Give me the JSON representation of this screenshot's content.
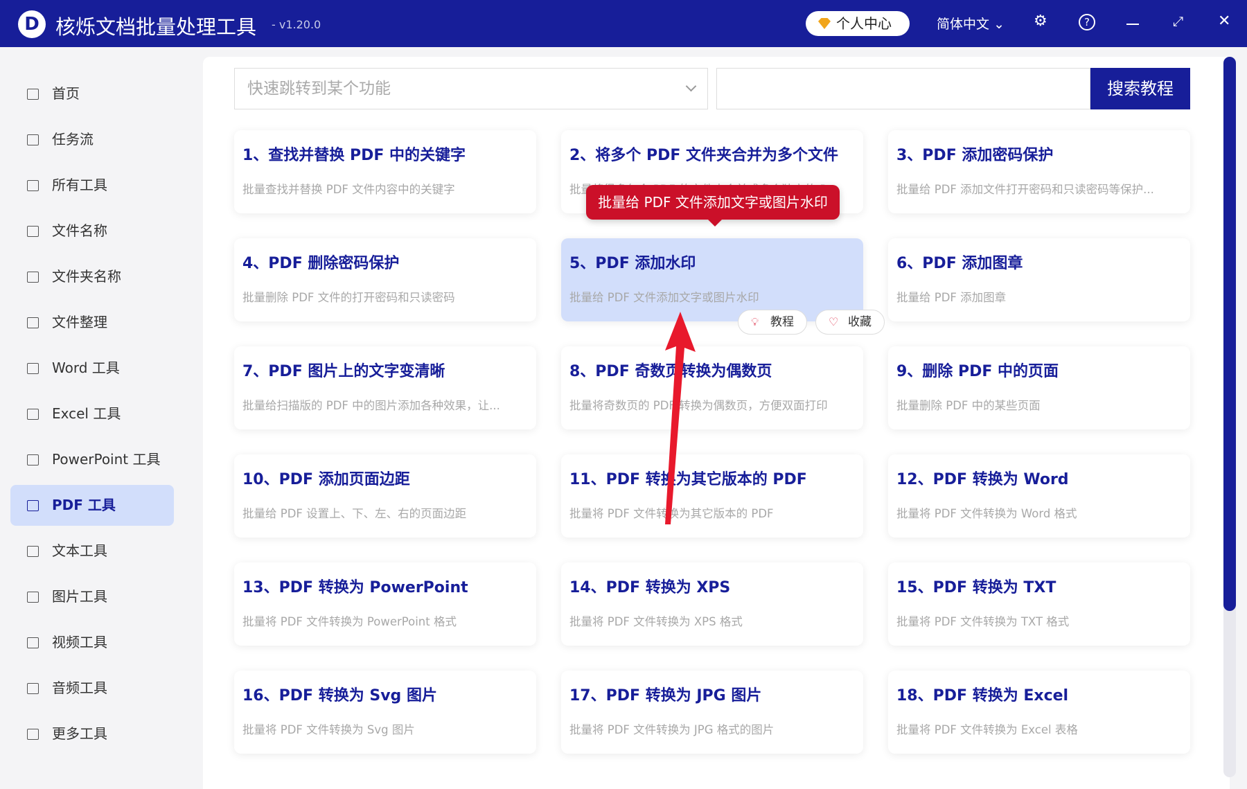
{
  "app": {
    "logo": "D",
    "title": "核烁文档批量处理工具",
    "version": "- v1.20.0",
    "user_center": "个人中心",
    "language": "简体中文"
  },
  "sidebar": {
    "items": [
      {
        "label": "首页",
        "icon": "home-icon"
      },
      {
        "label": "任务流",
        "icon": "workflow-icon"
      },
      {
        "label": "所有工具",
        "icon": "monitor-icon"
      },
      {
        "label": "文件名称",
        "icon": "file-icon"
      },
      {
        "label": "文件夹名称",
        "icon": "folder-icon"
      },
      {
        "label": "文件整理",
        "icon": "organize-icon"
      },
      {
        "label": "Word 工具",
        "icon": "word-icon"
      },
      {
        "label": "Excel 工具",
        "icon": "excel-icon"
      },
      {
        "label": "PowerPoint 工具",
        "icon": "ppt-icon"
      },
      {
        "label": "PDF 工具",
        "icon": "pdf-icon",
        "active": true
      },
      {
        "label": "文本工具",
        "icon": "text-icon"
      },
      {
        "label": "图片工具",
        "icon": "image-icon"
      },
      {
        "label": "视频工具",
        "icon": "video-icon"
      },
      {
        "label": "音频工具",
        "icon": "mic-icon"
      },
      {
        "label": "更多工具",
        "icon": "grid-icon"
      }
    ]
  },
  "search": {
    "placeholder": "快速跳转到某个功能",
    "button": "搜索教程"
  },
  "cards": [
    {
      "title": "1、查找并替换 PDF 中的关键字",
      "desc": "批量查找并替换 PDF 文件内容中的关键字"
    },
    {
      "title": "2、将多个 PDF 文件夹合并为多个文件",
      "desc": "批量将很多包含 PDF 的文件夹合并成多个独立的 P..."
    },
    {
      "title": "3、PDF 添加密码保护",
      "desc": "批量给 PDF 添加文件打开密码和只读密码等保护..."
    },
    {
      "title": "4、PDF 删除密码保护",
      "desc": "批量删除 PDF 文件的打开密码和只读密码"
    },
    {
      "title": "5、PDF 添加水印",
      "desc": "批量给 PDF 文件添加文字或图片水印"
    },
    {
      "title": "6、PDF 添加图章",
      "desc": "批量给 PDF 添加图章"
    },
    {
      "title": "7、PDF 图片上的文字变清晰",
      "desc": "批量给扫描版的 PDF 中的图片添加各种效果，让..."
    },
    {
      "title": "8、PDF 奇数页转换为偶数页",
      "desc": "批量将奇数页的 PDF 转换为偶数页，方便双面打印"
    },
    {
      "title": "9、删除 PDF 中的页面",
      "desc": "批量删除 PDF 中的某些页面"
    },
    {
      "title": "10、PDF 添加页面边距",
      "desc": "批量给 PDF 设置上、下、左、右的页面边距"
    },
    {
      "title": "11、PDF 转换为其它版本的 PDF",
      "desc": "批量将 PDF 文件转换为其它版本的 PDF"
    },
    {
      "title": "12、PDF 转换为 Word",
      "desc": "批量将 PDF 文件转换为 Word 格式"
    },
    {
      "title": "13、PDF 转换为 PowerPoint",
      "desc": "批量将 PDF 文件转换为 PowerPoint 格式"
    },
    {
      "title": "14、PDF 转换为 XPS",
      "desc": "批量将 PDF 文件转换为 XPS 格式"
    },
    {
      "title": "15、PDF 转换为 TXT",
      "desc": "批量将 PDF 文件转换为 TXT 格式"
    },
    {
      "title": "16、PDF 转换为 Svg 图片",
      "desc": "批量将 PDF 文件转换为 Svg 图片"
    },
    {
      "title": "17、PDF 转换为 JPG 图片",
      "desc": "批量将 PDF 文件转换为 JPG 格式的图片"
    },
    {
      "title": "18、PDF 转换为 Excel",
      "desc": "批量将 PDF 文件转换为 Excel 表格"
    }
  ],
  "tooltip": "批量给 PDF 文件添加文字或图片水印",
  "card_actions": {
    "tutorial": "教程",
    "favorite": "收藏"
  },
  "colors": {
    "primary": "#171e99",
    "highlight": "#d2defb",
    "tooltip": "#cb1029",
    "arrow": "#e8192c"
  }
}
